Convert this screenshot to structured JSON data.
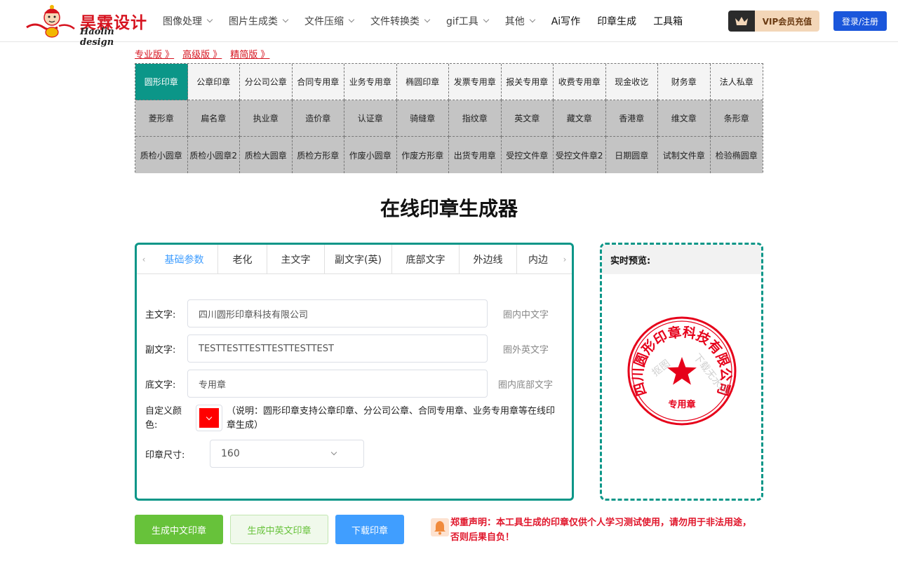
{
  "header": {
    "logo_cn": "昊霖设计",
    "logo_en": "Haolin design",
    "nav": [
      {
        "label": "图像处理",
        "dropdown": true
      },
      {
        "label": "图片生成类",
        "dropdown": true
      },
      {
        "label": "文件压缩",
        "dropdown": true
      },
      {
        "label": "文件转换类",
        "dropdown": true
      },
      {
        "label": "gif工具",
        "dropdown": true
      },
      {
        "label": "其他",
        "dropdown": true
      },
      {
        "label": "Ai写作",
        "dropdown": false
      },
      {
        "label": "印章生成",
        "dropdown": false
      },
      {
        "label": "工具箱",
        "dropdown": false
      }
    ],
    "vip_label": "VIP会员充值",
    "login_label": "登录/注册"
  },
  "versions": [
    "专业版 》",
    "高级版 》",
    "精简版 》"
  ],
  "stamp_types": [
    "圆形印章",
    "公章印章",
    "分公司公章",
    "合同专用章",
    "业务专用章",
    "椭圆印章",
    "发票专用章",
    "报关专用章",
    "收费专用章",
    "现金收讫",
    "财务章",
    "法人私章",
    "菱形章",
    "扁名章",
    "执业章",
    "造价章",
    "认证章",
    "骑缝章",
    "指纹章",
    "英文章",
    "藏文章",
    "香港章",
    "维文章",
    "条形章",
    "质检小圆章",
    "质检小圆章2",
    "质检大圆章",
    "质检方形章",
    "作废小圆章",
    "作废方形章",
    "出货专用章",
    "受控文件章",
    "受控文件章2",
    "日期圆章",
    "试制文件章",
    "检验椭圆章"
  ],
  "active_type_index": 0,
  "page_title": "在线印章生成器",
  "tabs": [
    {
      "label": "基础参数",
      "width": 96
    },
    {
      "label": "老化",
      "width": 70
    },
    {
      "label": "主文字",
      "width": 82
    },
    {
      "label": "副文字(英)",
      "width": 96
    },
    {
      "label": "底部文字",
      "width": 96
    },
    {
      "label": "外边线",
      "width": 82
    },
    {
      "label": "内边",
      "width": 60
    }
  ],
  "form": {
    "main_text_label": "主文字:",
    "main_text_value": "四川圆形印章科技有限公司",
    "main_text_hint": "圈内中文字",
    "sub_text_label": "副文字:",
    "sub_text_value": "TESTTESTTESTTESTTESTTEST",
    "sub_text_hint": "圈外英文字",
    "bottom_text_label": "底文字:",
    "bottom_text_value": "专用章",
    "bottom_text_hint": "圈内底部文字",
    "color_label": "自定义颜色:",
    "color_value": "#ff0000",
    "note": "（说明：圆形印章支持公章印章、分公司公章、合同专用章、业务专用章等在线印章生成）",
    "size_label": "印章尺寸:",
    "size_value": "160"
  },
  "preview": {
    "title": "实时预览:",
    "stamp_main": "四川圆形印章科技有限公司",
    "stamp_bottom": "专用章",
    "watermark_1": "抠图",
    "watermark_2": "下载无水印",
    "color": "#e6001a"
  },
  "actions": {
    "gen_cn": "生成中文印章",
    "gen_cn_en": "生成中英文印章",
    "download": "下载印章"
  },
  "notice": "郑重声明：本工具生成的印章仅供个人学习测试使用，请勿用于非法用途，否则后果自负！"
}
